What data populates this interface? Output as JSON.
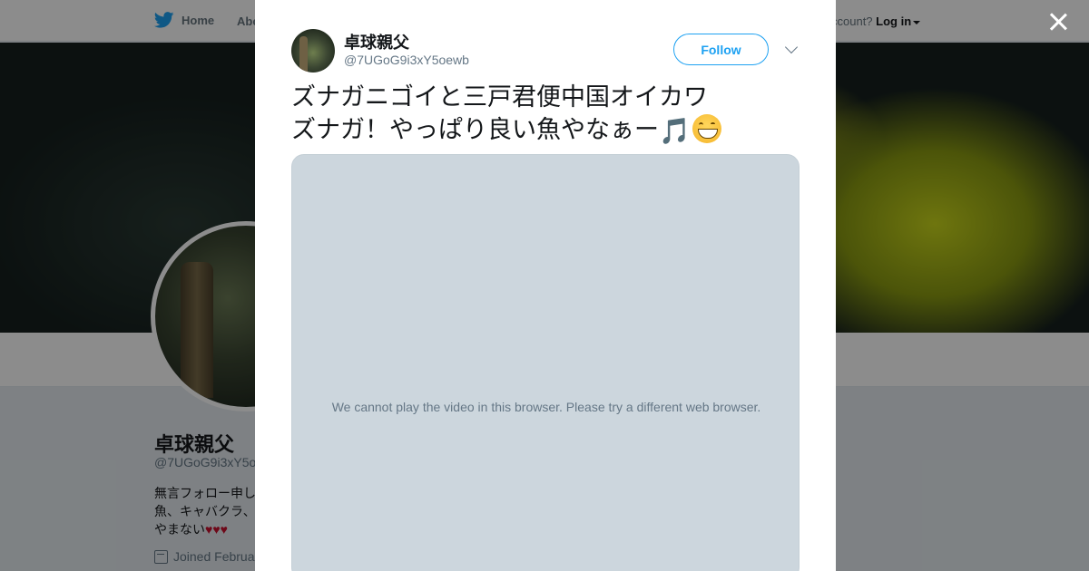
{
  "nav": {
    "home_label": "Home",
    "about_label": "Abo",
    "login_prefix": "ccount?",
    "login_label": "Log in"
  },
  "profile": {
    "name": "卓球親父",
    "handle": "@7UGoG9i3xY5o",
    "bio_line1": "無言フォロー申し",
    "bio_line2": "魚、キャバクラ、",
    "bio_line3": "やまない♥♥♥",
    "joined": "Joined Februa"
  },
  "tweet": {
    "author_name": "卓球親父",
    "author_handle": "@7UGoG9i3xY5oewb",
    "follow_label": "Follow",
    "text_line1": "ズナガニゴイと三戸君便中国オイカワ",
    "text_line2": "ズナガ！やっぱり良い魚やなぁー",
    "emoji_note": "🎵",
    "video_message": "We cannot play the video in this browser. Please try a different web browser."
  },
  "colors": {
    "accent": "#1da1f2",
    "video_bg": "#ccd6dd",
    "overlay": "rgba(0,0,0,0.45)"
  },
  "icons": [
    "twitter-bird-icon",
    "close-icon",
    "chevron-down-icon",
    "calendar-icon",
    "music-note-emoji",
    "grinning-face-emoji"
  ]
}
